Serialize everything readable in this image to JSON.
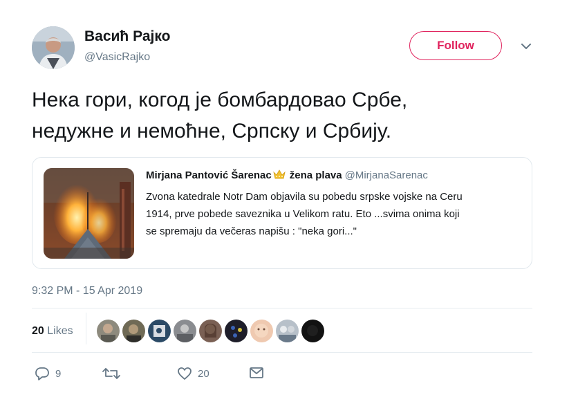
{
  "author": {
    "display_name": "Васић Рајко",
    "handle": "@VasicRajko",
    "avatar_icon": "user-avatar"
  },
  "follow_button": {
    "label": "Follow",
    "color": "#e0245e"
  },
  "menu_icon": "chevron-down-icon",
  "tweet_text": "Нека гори, когод је бомбардовао Србе,\nнедужне и немоћне, Српску и Србију.",
  "quoted_tweet": {
    "name": "Mirjana Pantović Šarenac",
    "name_suffix": "žena plava",
    "handle": "@MirjanaSarenac",
    "emoji": "crown-emoji",
    "text": "Zvona katedrale Notr Dam objavila su pobedu srpske vojske na Ceru\n1914, prve pobede saveznika u Velikom ratu. Eto ...svima onima koji\nse spremaju da večeras napišu : \"neka gori...\"",
    "image": "burning-cathedral-spire"
  },
  "timestamp": "9:32 PM - 15 Apr 2019",
  "likes": {
    "count": "20",
    "label": "Likes"
  },
  "actions": {
    "reply_count": "9",
    "retweet_count": "",
    "like_count": "20"
  },
  "colors": {
    "accent": "#e0245e",
    "text": "#14171a",
    "secondary": "#657786",
    "border": "#e1e8ed"
  }
}
